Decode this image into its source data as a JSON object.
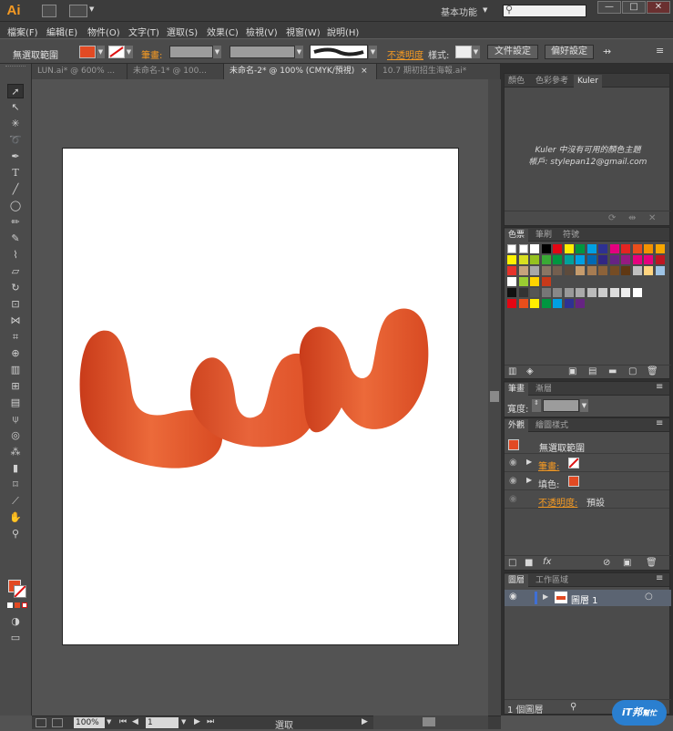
{
  "app": {
    "logo": "Ai",
    "workspace": "基本功能",
    "search_placeholder": "",
    "win_min": "—",
    "win_max": "□",
    "win_close": "✕"
  },
  "menu": [
    "檔案(F)",
    "編輯(E)",
    "物件(O)",
    "文字(T)",
    "選取(S)",
    "效果(C)",
    "檢視(V)",
    "視窗(W)",
    "說明(H)"
  ],
  "control": {
    "selection": "無選取範圍",
    "stroke_label": "筆畫:",
    "opacity_label": "不透明度",
    "style_label": "樣式:",
    "doc_setup": "文件設定",
    "prefs": "偏好設定"
  },
  "tabs": [
    "LUN.ai* @ 600% ...",
    "未命名-1* @ 100...",
    "未命名-2* @ 100% (CMYK/預視)",
    "10.7 期初招生海報.ai*"
  ],
  "artwork_text": "LUN",
  "colors": {
    "accent": "#f59a23",
    "art_dark": "#c93b1a",
    "art_light": "#ec6a3a"
  },
  "kuler": {
    "tabs": [
      "顏色",
      "色彩參考",
      "Kuler"
    ],
    "message": "Kuler 中沒有可用的顏色主題",
    "account": "帳戶: stylepan12@gmail.com"
  },
  "swatches": {
    "tabs": [
      "色票",
      "筆刷",
      "符號"
    ]
  },
  "stroke": {
    "tabs": [
      "筆畫",
      "漸層"
    ],
    "weight_label": "寬度:"
  },
  "appearance": {
    "tabs": [
      "外觀",
      "繪圖樣式"
    ],
    "title": "無選取範圍",
    "stroke": "筆畫:",
    "fill": "填色:",
    "opacity": "不透明度:",
    "opacity_value": "預設"
  },
  "layers": {
    "tabs": [
      "圖層",
      "工作區域"
    ],
    "layer_name": "圖層 1",
    "count": "1 個圖層"
  },
  "status": {
    "zoom": "100%",
    "page": "1",
    "tool": "選取"
  },
  "watermark": {
    "line1": "iT邦",
    "line2": "幫忙"
  }
}
